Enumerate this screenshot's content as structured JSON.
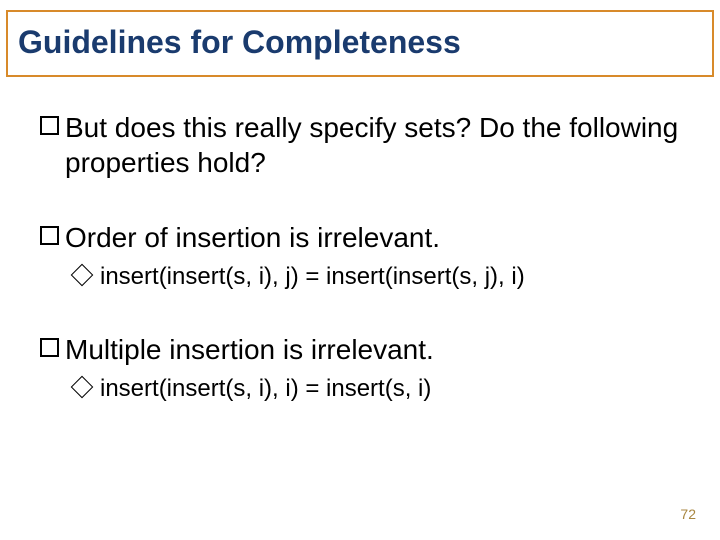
{
  "title": "Guidelines for Completeness",
  "bullets": [
    {
      "text": "But does this really specify sets? Do the following properties hold?",
      "sub": null
    },
    {
      "text": "Order of insertion is irrelevant.",
      "sub": "insert(insert(s, i), j) = insert(insert(s, j), i)"
    },
    {
      "text": "Multiple insertion is irrelevant.",
      "sub": "insert(insert(s, i), i) = insert(s, i)"
    }
  ],
  "page_number": "72"
}
